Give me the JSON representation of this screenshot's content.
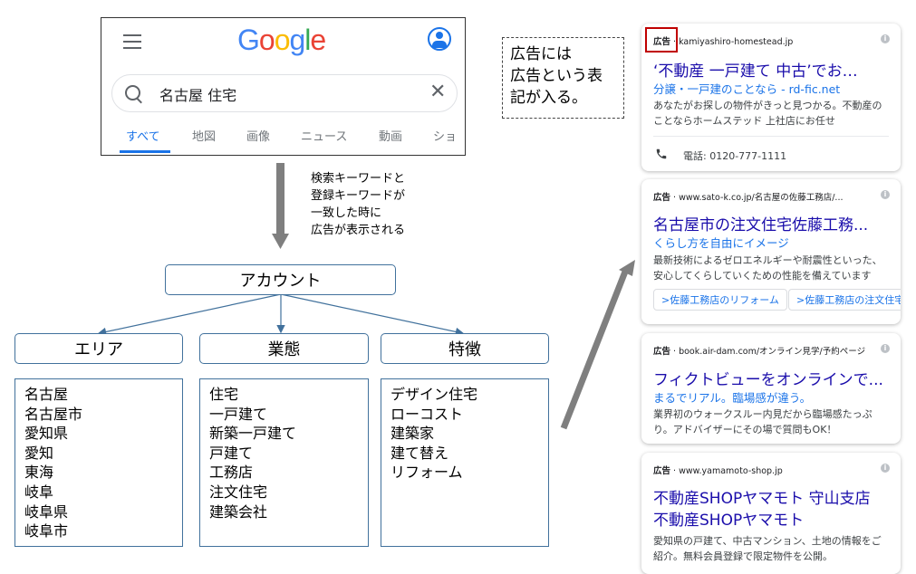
{
  "google": {
    "logo_letters": [
      {
        "ch": "G",
        "color": "#4285F4"
      },
      {
        "ch": "o",
        "color": "#EA4335"
      },
      {
        "ch": "o",
        "color": "#FBBC05"
      },
      {
        "ch": "g",
        "color": "#4285F4"
      },
      {
        "ch": "l",
        "color": "#34A853"
      },
      {
        "ch": "e",
        "color": "#EA4335"
      }
    ],
    "query": "名古屋 住宅",
    "clear_glyph": "✕",
    "tabs": [
      "すべて",
      "地図",
      "画像",
      "ニュース",
      "動画",
      "ショ"
    ],
    "active_tab": "すべて",
    "accent": "#1a73e8"
  },
  "annotations": {
    "flow_note": [
      "検索キーワードと",
      "登録キーワードが",
      "一致した時に",
      "広告が表示される"
    ],
    "ad_label_note": [
      "広告には",
      "広告という表",
      "記が入る。"
    ]
  },
  "tree": {
    "root": "アカウント",
    "categories": [
      {
        "label": "エリア",
        "items": [
          "名古屋",
          "名古屋市",
          "愛知県",
          "愛知",
          "東海",
          "岐阜",
          "岐阜県",
          "岐阜市"
        ]
      },
      {
        "label": "業態",
        "items": [
          "住宅",
          "一戸建て",
          "新築一戸建て",
          "戸建て",
          "工務店",
          "注文住宅",
          "建築会社"
        ]
      },
      {
        "label": "特徴",
        "items": [
          "デザイン住宅",
          "ローコスト",
          "建築家",
          "建て替え",
          "リフォーム"
        ]
      }
    ],
    "border_color": "#41719c"
  },
  "ads": [
    {
      "label": "広告",
      "url": "kamiyashiro-homestead.jp",
      "title": "‘不動産 一戸建て 中古’でお…",
      "sub": "分譲・一戸建のことなら - rd-fic.net",
      "desc": "あなたがお探しの物件がきっと見つかる。不動産のことならホームステッド 上社店にお任せ",
      "phone": "電話: 0120-777-1111"
    },
    {
      "label": "広告",
      "url": "www.sato-k.co.jp/名古屋の佐藤工務店/...",
      "title": "名古屋市の注文住宅佐藤工務...",
      "sub": "くらし方を自由にイメージ",
      "desc": "最新技術によるゼロエネルギーや耐震性といった、安心してくらしていくための性能を備えています",
      "chips": [
        ">佐藤工務店のリフォーム",
        ">佐藤工務店の注文住宅"
      ]
    },
    {
      "label": "広告",
      "url": "book.air-dam.com/オンライン見学/予約ページ",
      "title": "フィクトビューをオンラインで...",
      "sub": "まるでリアル。臨場感が違う。",
      "desc": "業界初のウォークスルー内見だから臨場感たっぷり。アドバイザーにその場で質問もOK！"
    },
    {
      "label": "広告",
      "url": "www.yamamoto-shop.jp",
      "title": "不動産SHOPヤマモト 守山支店",
      "title2": "不動産SHOPヤマモト",
      "desc": "愛知県の戸建て、中古マンション、土地の情報をご紹介。無料会員登録で限定物件を公開。"
    }
  ],
  "colors": {
    "ad_title": "#1a0dab",
    "highlight": "#c00000",
    "arrow": "#7f7f7f"
  }
}
